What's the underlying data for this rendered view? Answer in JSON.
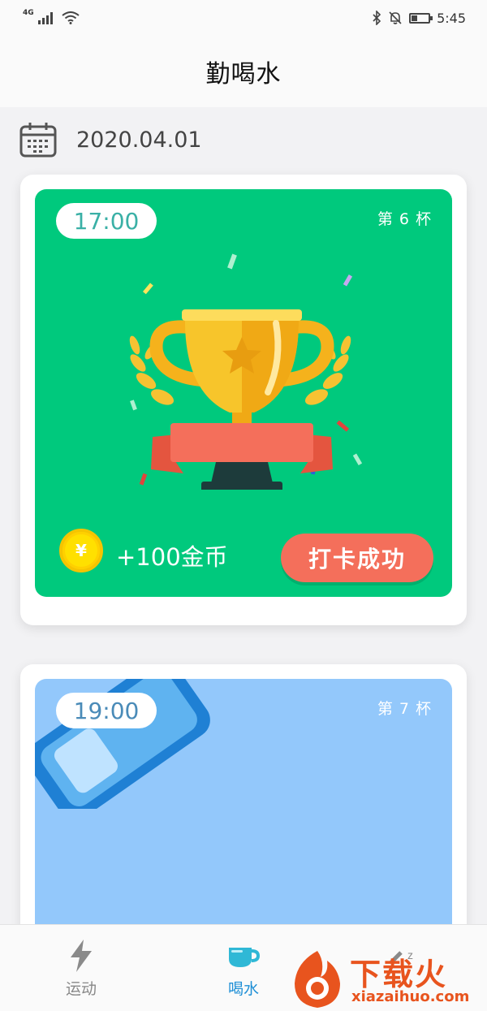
{
  "status_bar": {
    "network": "4G",
    "time": "5:45"
  },
  "header": {
    "title": "勤喝水"
  },
  "date": {
    "value": "2020.04.01"
  },
  "cards": [
    {
      "time": "17:00",
      "cup_label": "第 6 杯",
      "reward": "+100金币",
      "coin_symbol": "¥",
      "button": "打卡成功",
      "bg_color": "#00c97d"
    },
    {
      "time": "19:00",
      "cup_label": "第 7 杯",
      "bg_color": "#93c8fb"
    }
  ],
  "tabs": [
    {
      "label": "运动",
      "icon": "lightning-icon"
    },
    {
      "label": "喝水",
      "icon": "cup-icon",
      "active": true
    },
    {
      "label": "",
      "icon": "sleep-icon"
    }
  ],
  "watermark": {
    "title": "下载火",
    "url": "xiazaihuo.com"
  },
  "colors": {
    "accent": "#1e8fd6",
    "success_green": "#00c97d",
    "button_red": "#f46f5b",
    "card2_blue": "#93c8fb"
  }
}
